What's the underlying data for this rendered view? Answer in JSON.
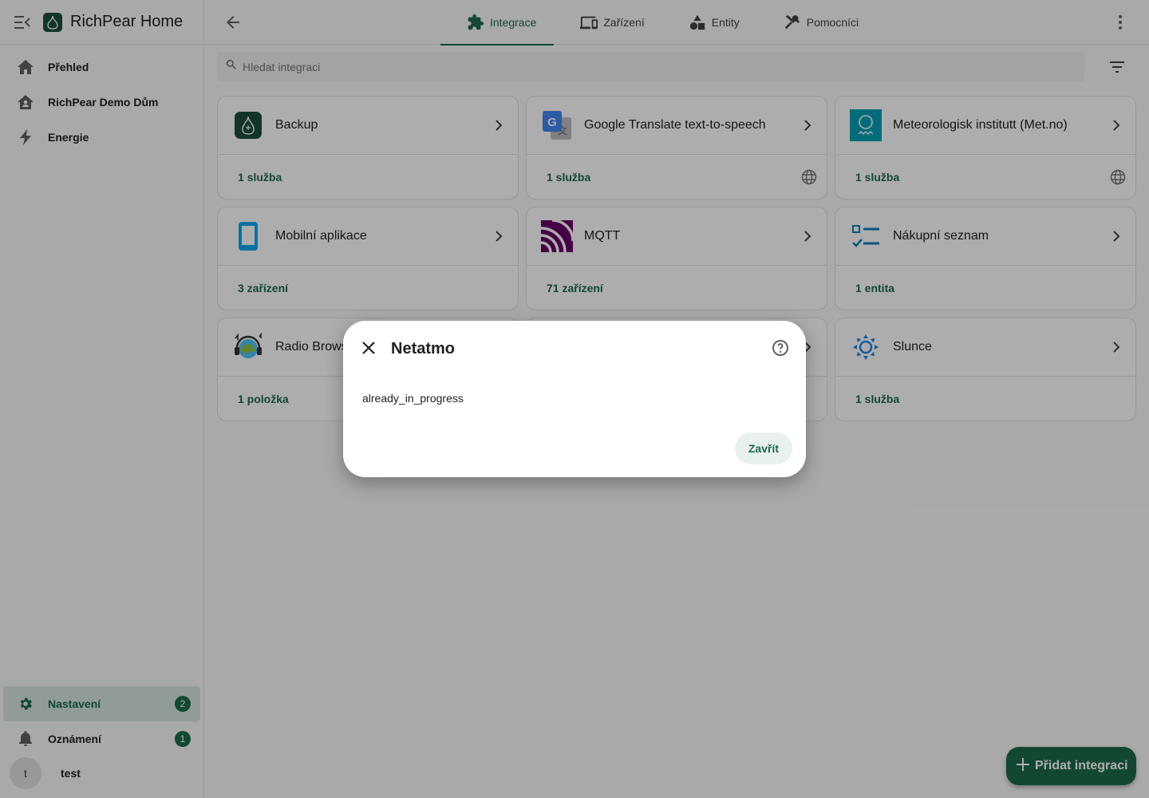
{
  "app": {
    "title": "RichPear Home"
  },
  "sidebar": {
    "items": [
      {
        "label": "Přehled",
        "icon": "home-icon"
      },
      {
        "label": "RichPear Demo Dům",
        "icon": "home-account-icon"
      },
      {
        "label": "Energie",
        "icon": "lightning-icon"
      }
    ],
    "bottom": [
      {
        "label": "Nastavení",
        "icon": "gear-icon",
        "badge": "2"
      },
      {
        "label": "Oznámení",
        "icon": "bell-icon",
        "badge": "1"
      }
    ],
    "user": {
      "initial": "t",
      "name": "test"
    }
  },
  "tabs": [
    {
      "label": "Integrace",
      "icon": "puzzle-icon"
    },
    {
      "label": "Zařízení",
      "icon": "devices-icon"
    },
    {
      "label": "Entity",
      "icon": "shapes-icon"
    },
    {
      "label": "Pomocníci",
      "icon": "tools-icon"
    }
  ],
  "search": {
    "placeholder": "Hledat integraci"
  },
  "cards": [
    {
      "title": "Backup",
      "link": "1 služba",
      "cloud": false
    },
    {
      "title": "Google Translate text-to-speech",
      "link": "1 služba",
      "cloud": true
    },
    {
      "title": "Meteorologisk institutt (Met.no)",
      "link": "1 služba",
      "cloud": true
    },
    {
      "title": "Mobilní aplikace",
      "link": "3 zařízení",
      "cloud": false
    },
    {
      "title": "MQTT",
      "link": "71 zařízení",
      "cloud": false
    },
    {
      "title": "Nákupní seznam",
      "link": "1 entita",
      "cloud": false
    },
    {
      "title": "Radio Browser",
      "link": "1 položka",
      "cloud": false
    },
    {
      "title": "",
      "link": "",
      "cloud": false
    },
    {
      "title": "Slunce",
      "link": "1 služba",
      "cloud": false
    }
  ],
  "dialog": {
    "title": "Netatmo",
    "message": "already_in_progress",
    "close_label": "Zavřít"
  },
  "fab": {
    "label": "Přidat integraci"
  },
  "colors": {
    "primary": "#1b6b4a",
    "scrim": "rgba(0,0,0,0.32)"
  }
}
